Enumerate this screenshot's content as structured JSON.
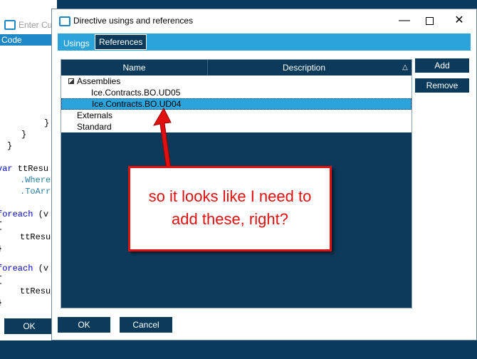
{
  "background_window": {
    "title": "Enter Cus",
    "code_header": "Code",
    "code_lines": [
      {
        "text": "}"
      },
      {
        "text": "}"
      },
      {
        "text": "}"
      },
      {
        "kw": "var",
        "text": " ttResu"
      },
      {
        "text": ".Where"
      },
      {
        "text": ".ToArr"
      },
      {
        "kw": "foreach",
        "text": " (v"
      },
      {
        "text": "{"
      },
      {
        "text": "ttResu"
      },
      {
        "text": "}"
      },
      {
        "kw": "foreach",
        "text": " (v"
      },
      {
        "text": "{"
      },
      {
        "text": "ttResu"
      },
      {
        "text": "}"
      }
    ],
    "ok_label": "OK"
  },
  "dialog": {
    "title": "Directive usings and references",
    "tabs": [
      {
        "label": "Usings",
        "active": false
      },
      {
        "label": "References",
        "active": true
      }
    ],
    "grid": {
      "columns": [
        "Name",
        "Description"
      ],
      "sort_icon": "△",
      "rows": [
        {
          "label": "Assemblies",
          "level": 0,
          "expanded": true,
          "selected": false
        },
        {
          "label": "Ice.Contracts.BO.UD05",
          "level": 1,
          "selected": false
        },
        {
          "label": "Ice.Contracts.BO.UD04",
          "level": 1,
          "selected": true
        },
        {
          "label": "Externals",
          "level": 0,
          "selected": false
        },
        {
          "label": "Standard",
          "level": 0,
          "selected": false
        }
      ]
    },
    "side_buttons": {
      "add": "Add",
      "remove": "Remove"
    },
    "footer": {
      "ok": "OK",
      "cancel": "Cancel"
    },
    "window_controls": {
      "minimize": "—",
      "close": "✕"
    }
  },
  "annotation": {
    "text": "so it looks like I need to add these, right?",
    "color": "#e01010"
  },
  "colors": {
    "accent": "#2ba4dc",
    "dark": "#0b3a5a"
  }
}
